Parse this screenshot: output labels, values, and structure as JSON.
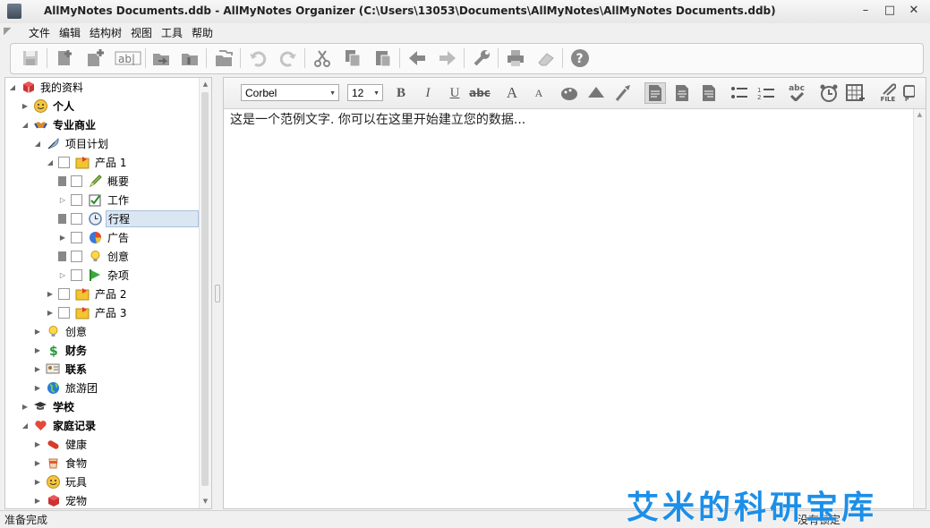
{
  "window": {
    "title": "AllMyNotes Documents.ddb - AllMyNotes Organizer (C:\\Users\\13053\\Documents\\AllMyNotes\\AllMyNotes Documents.ddb)",
    "min_glyph": "–",
    "max_glyph": "□",
    "close_glyph": "✕"
  },
  "menu": [
    "文件",
    "编辑",
    "结构树",
    "视图",
    "工具",
    "帮助"
  ],
  "toolbar": {
    "icons": [
      "save-icon",
      "add-note-icon",
      "add-child-note-icon",
      "rename-icon",
      "move-folder-icon",
      "move-folder-alt-icon",
      "clone-icon",
      "undo-icon",
      "redo-icon",
      "cut-icon",
      "copy-icon",
      "paste-icon",
      "back-icon",
      "forward-icon",
      "settings-wrench-icon",
      "print-icon",
      "eraser-icon",
      "help-icon"
    ]
  },
  "tree": {
    "items": [
      {
        "label": "我的资料",
        "icon": "notebook-icon",
        "bold": false
      },
      {
        "label": "个人",
        "icon": "smiley-icon",
        "bold": true
      },
      {
        "label": "专业商业",
        "icon": "handshake-icon",
        "bold": true
      },
      {
        "label": "项目计划",
        "icon": "feather-icon",
        "bold": false
      },
      {
        "label": "产品 1",
        "icon": "mail-folder-icon",
        "bold": false
      },
      {
        "label": "概要",
        "icon": "pencil-icon",
        "bold": false
      },
      {
        "label": "工作",
        "icon": "checkbox-icon",
        "bold": false
      },
      {
        "label": "行程",
        "icon": "clock-icon",
        "bold": false,
        "selected": true
      },
      {
        "label": "广告",
        "icon": "pie-chart-icon",
        "bold": false
      },
      {
        "label": "创意",
        "icon": "lightbulb-icon",
        "bold": false
      },
      {
        "label": "杂项",
        "icon": "arrow-flag-icon",
        "bold": false
      },
      {
        "label": "产品 2",
        "icon": "mail-folder-icon",
        "bold": false
      },
      {
        "label": "产品 3",
        "icon": "mail-folder-icon",
        "bold": false
      },
      {
        "label": "创意",
        "icon": "lightbulb-icon",
        "bold": false
      },
      {
        "label": "财务",
        "icon": "dollar-icon",
        "bold": true
      },
      {
        "label": "联系",
        "icon": "contact-card-icon",
        "bold": true
      },
      {
        "label": "旅游团",
        "icon": "globe-icon",
        "bold": false
      },
      {
        "label": "学校",
        "icon": "graduation-cap-icon",
        "bold": true
      },
      {
        "label": "家庭记录",
        "icon": "heart-icon",
        "bold": true
      },
      {
        "label": "健康",
        "icon": "pill-icon",
        "bold": false
      },
      {
        "label": "食物",
        "icon": "cup-icon",
        "bold": false
      },
      {
        "label": "玩具",
        "icon": "smiley-icon",
        "bold": false
      },
      {
        "label": "宠物",
        "icon": "notebook-icon",
        "bold": false
      }
    ]
  },
  "format": {
    "font": "Corbel",
    "size": "12",
    "bold": "B",
    "italic": "I",
    "underline": "U",
    "strike": "abc",
    "grow": "A",
    "shrink": "A",
    "spell": "abc",
    "file": "FILE"
  },
  "editor": {
    "content": "这是一个范例文字. 你可以在这里开始建立您的数据..."
  },
  "status": {
    "left": "准备完成",
    "right": "没有锁定"
  },
  "watermark": "艾米的科研宝库",
  "colors": {
    "accent": "#1c8fe8",
    "selection": "#dbe6f3"
  }
}
